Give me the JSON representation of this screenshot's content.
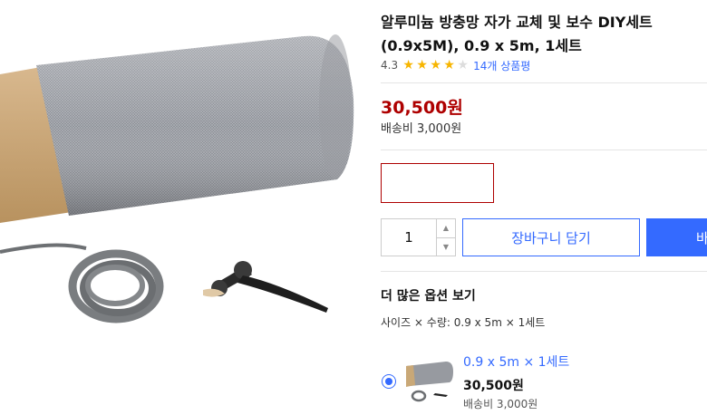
{
  "product": {
    "title_line1": "알루미늄 방충망 자가 교체 및 보수 DIY세트",
    "title_line2": "(0.9x5M), 0.9 x 5m, 1세트",
    "rating_score": "4.3",
    "rating_fraction": 0.86,
    "review_link": "14개 상품평",
    "price": "30,500원",
    "shipping": "배송비 3,000원"
  },
  "purchase": {
    "quantity": "1",
    "qty_up_icon": "chevron-up-icon",
    "qty_down_icon": "chevron-down-icon",
    "cart_label": "장바구니 담기",
    "buy_label": "바"
  },
  "options": {
    "heading": "더 많은 옵션 보기",
    "summary": "사이즈 × 수량: 0.9 x 5m × 1세트",
    "items": [
      {
        "name": "0.9 x 5m × 1세트",
        "price": "30,500원",
        "shipping": "배송비 3,000원",
        "selected": true
      }
    ]
  },
  "colors": {
    "accent_blue": "#346aff",
    "price_red": "#ae0000",
    "star_yellow": "#f7b500",
    "star_empty": "#dddddd"
  }
}
